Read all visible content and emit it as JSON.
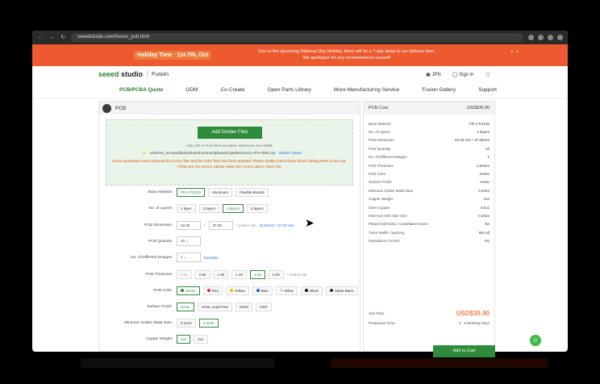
{
  "browser": {
    "url": "seeedstudio.com/fusion_pcb.html"
  },
  "banner": {
    "holiday": "Holiday Time · 1st-7th, Oct",
    "message": "Due to the upcoming National Day Holiday, there will be a 7-day delay in our delivery time. We apologize for any inconvenience caused!"
  },
  "header": {
    "logo": "seeed studio",
    "product": "Fusion",
    "lang": "JPN",
    "signin": "Sign in"
  },
  "nav": [
    "PCB/PCBA Quote",
    "ODM",
    "Co-Create",
    "Open Parts Library",
    "More Manufacturing Service",
    "Fusion Gallery",
    "Support"
  ],
  "pcb": {
    "title": "PCB",
    "add_gerber": "Add Gerber Files",
    "only_text": "Only ZIP or RAR files accepted. Maximum size 20MB",
    "file_name": "1445701_mcseeedfusionboardcommunityboards?gerbersource=PTA-0001.zip",
    "gerber_viewer": "Gerber Viewer",
    "warning": "Some parameters were extracted from your files and the order form has been updated. Please double check these before adding them to the cart. If they are not correct, please select the correct option. More info",
    "rows": {
      "base_material": {
        "label": "Base Material",
        "options": [
          "FR-4 TG130",
          "Aluminum",
          "Flexible Boards"
        ],
        "selected": 0
      },
      "layers": {
        "label": "No. of Layers",
        "options": [
          "1 layer",
          "2 layers",
          "4 layers",
          "6 layers"
        ],
        "selected": 2
      },
      "dimension": {
        "label": "PCB Dimension",
        "w": "42.00",
        "sep": "*",
        "h": "37.00",
        "unit": "* Units in mm",
        "detected": "42.00mm * 37.00 mm"
      },
      "quantity": {
        "label": "PCB Quantity",
        "value": "10"
      },
      "designs": {
        "label": "No. of Different Designs",
        "value": "1",
        "example": "Example"
      },
      "thickness": {
        "label": "PCB Thickness",
        "options": [
          "0.60",
          "0.80",
          "1.00",
          "1.20",
          "1.60",
          "2.00"
        ],
        "selected": 4,
        "unit": "* Units in mm"
      },
      "color": {
        "label": "PCB Color",
        "options": [
          "Green",
          "Red",
          "Yellow",
          "Blue",
          "White",
          "Black",
          "Matte Black"
        ],
        "selected": 0
      },
      "finish": {
        "label": "Surface Finish",
        "options": [
          "HASL",
          "HASL Lead Free",
          "ENIG",
          "OSP"
        ],
        "selected": 0
      },
      "mask": {
        "label": "Minimum Solder Mask Dam",
        "options": [
          "0.1mm",
          "0.4mm"
        ],
        "selected": 1
      },
      "copper": {
        "label": "Copper Weight",
        "options": [
          "1oz",
          "2oz"
        ],
        "selected": 0
      }
    }
  },
  "cost": {
    "title": "PCB Cost",
    "price": "USD$39.90",
    "specs": [
      {
        "k": "Base Material",
        "v": "FR-4 TG130"
      },
      {
        "k": "No. of Layers",
        "v": "4 layers"
      },
      {
        "k": "PCB Dimension",
        "v": "42.00 mm * 37.00mm"
      },
      {
        "k": "PCB Quantity",
        "v": "10"
      },
      {
        "k": "No. of Different Designs",
        "v": "1"
      },
      {
        "k": "PCB Thickness",
        "v": "1.60mm"
      },
      {
        "k": "PCB Color",
        "v": "Green"
      },
      {
        "k": "Surface Finish",
        "v": "HASL"
      },
      {
        "k": "Minimum Solder Mask Dam",
        "v": "0.4mm"
      },
      {
        "k": "Copper Weight",
        "v": "1oz"
      },
      {
        "k": "Inner Copper",
        "v": "0.5oz"
      },
      {
        "k": "Minimum Drill Hole Size",
        "v": "0.3mm"
      },
      {
        "k": "Plated Half-holes / Castellated Holes",
        "v": "No"
      },
      {
        "k": "Trace Width / Spacing",
        "v": "6/6 mil"
      },
      {
        "k": "Impedance Control",
        "v": "No"
      }
    ],
    "subtotal_label": "Sub Total:",
    "subtotal": "USD$39.90",
    "production_label": "Production Time:",
    "production": "4 - 6 Working Days",
    "cart": "Add to Cart"
  },
  "colors": {
    "brand": "#2e8b3a",
    "banner": "#ee5a2f",
    "accent": "#ee7d4a"
  }
}
